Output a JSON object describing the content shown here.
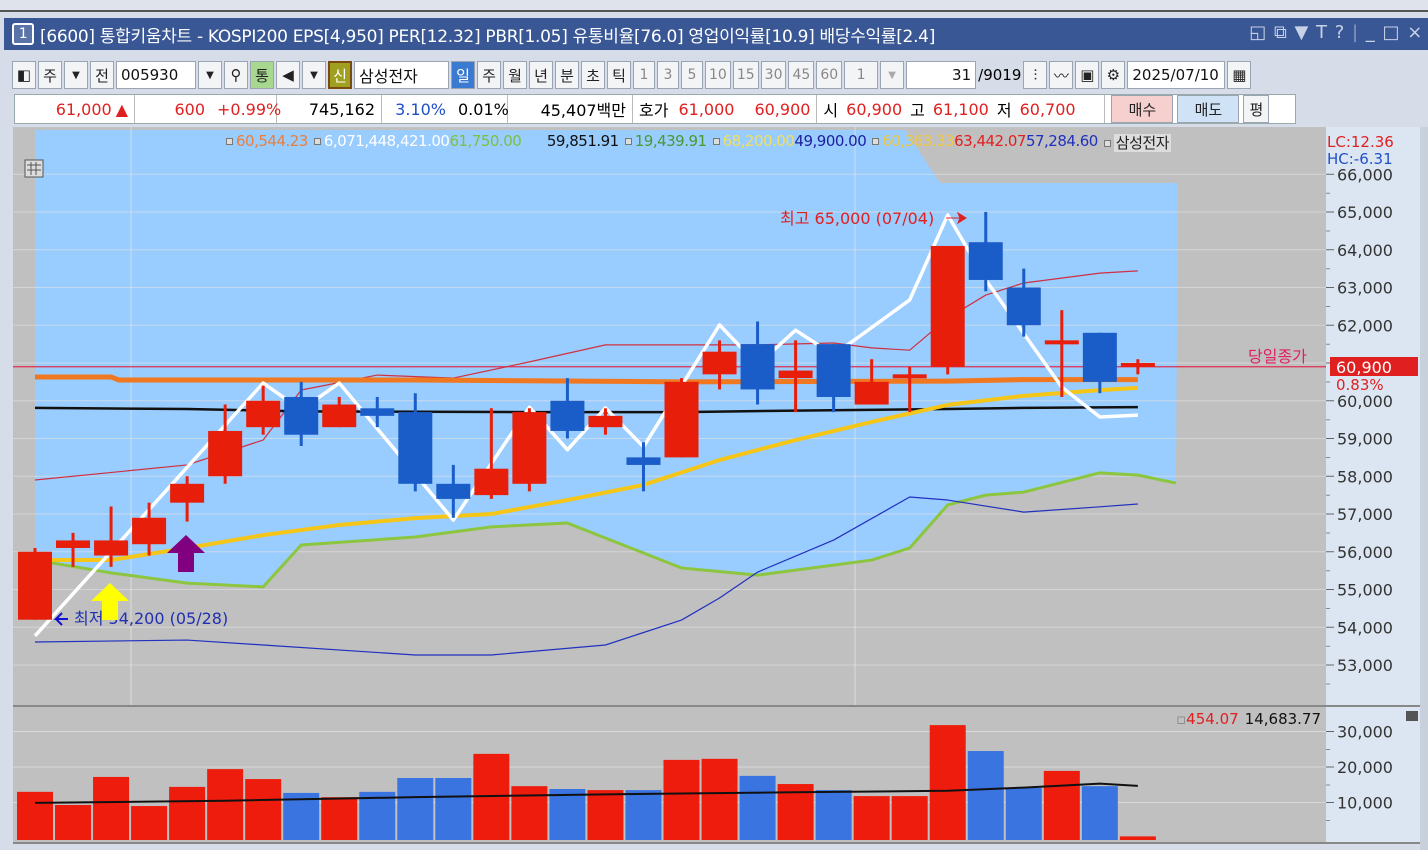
{
  "title_bar": {
    "badge": "1",
    "text": "[6600] 통합키움차트 - KOSPI200 EPS[4,950] PER[12.32] PBR[1.05] 유통비율[76.0] 영업이익률[10.9] 배당수익률[2.4]",
    "icons": [
      "window-icon",
      "restore-icon",
      "pin-icon",
      "font-icon",
      "help-icon",
      "minimize-icon",
      "maximize-icon",
      "close-icon"
    ],
    "icon_glyphs": [
      "◱",
      "⧉",
      "🖈",
      "T",
      "?",
      "_",
      "□",
      "×"
    ]
  },
  "toolbar": {
    "market": "주",
    "prev": "전",
    "code": "005930",
    "tong": "통",
    "new": "신",
    "name": "삼성전자",
    "periods": [
      "일",
      "주",
      "월",
      "년",
      "분",
      "초",
      "틱"
    ],
    "active_period": "일",
    "intervals": [
      "1",
      "3",
      "5",
      "10",
      "15",
      "30",
      "45",
      "60"
    ],
    "interval_select": "1",
    "count": "31",
    "total": "/9019",
    "date": "2025/07/10"
  },
  "info": {
    "price": "61,000",
    "arrow": "▲",
    "change": "600",
    "change_pct": "+0.99%",
    "volume": "745,162",
    "turnover": "3.10%",
    "ratio": "0.01%",
    "amount": "45,407백만",
    "quote_label": "호가",
    "ask": "61,000",
    "bid": "60,900",
    "open_label": "시",
    "open": "60,900",
    "high_label": "고",
    "high": "61,100",
    "low_label": "저",
    "low": "60,700",
    "buy": "매수",
    "sell": "매도",
    "avg": "평"
  },
  "legend": [
    {
      "text": "60,544.23",
      "color": "#e8803a",
      "box": true
    },
    {
      "text": "6,071,448,421.00",
      "color": "#ffffff",
      "box": true
    },
    {
      "text": "61,750.00",
      "color": "#7cc040",
      "box": false
    },
    {
      "text": "      59,851.91",
      "color": "#111111",
      "box": false
    },
    {
      "text": "19,439.91",
      "color": "#4a9a30",
      "box": true
    },
    {
      "text": "68,200.00",
      "color": "#f0e060",
      "box": true
    },
    {
      "text": "49,900.00",
      "color": "#2020a0",
      "box": false
    },
    {
      "text": "60,363.33",
      "color": "#f0c840",
      "box": true
    },
    {
      "text": "63,442.07",
      "color": "#e02020",
      "box": false
    },
    {
      "text": "57,284.60",
      "color": "#2030c0",
      "box": false
    },
    {
      "text": "삼성전자",
      "color": "#222222",
      "box": true
    }
  ],
  "indicators": {
    "lc": "LC:12.36",
    "hc": "HC:-6.31"
  },
  "annotations": {
    "high": "최고 65,000 (07/04)",
    "low": "최저 54,200 (05/28)",
    "close_label": "당일종가",
    "close_price": "60,900",
    "close_pct": "0.83%"
  },
  "volume_legend": {
    "v1": "454.07",
    "v2": "14,683.77"
  },
  "chart_data": {
    "type": "candlestick",
    "price_ticks": [
      "66,000",
      "65,000",
      "64,000",
      "63,000",
      "62,000",
      "61,000",
      "60,000",
      "59,000",
      "58,000",
      "57,000",
      "56,000",
      "55,000",
      "54,000",
      "53,000"
    ],
    "price_tick_values": [
      66000,
      65000,
      64000,
      63000,
      62000,
      61000,
      60000,
      59000,
      58000,
      57000,
      56000,
      55000,
      54000,
      53000
    ],
    "volume_ticks": [
      "30,000",
      "20,000",
      "10,000"
    ],
    "volume_tick_values": [
      30000,
      20000,
      10000
    ],
    "candles": [
      {
        "o": 54200,
        "h": 56100,
        "l": 54200,
        "c": 56000
      },
      {
        "o": 56100,
        "h": 56500,
        "l": 55600,
        "c": 56300
      },
      {
        "o": 55900,
        "h": 57200,
        "l": 55600,
        "c": 56300
      },
      {
        "o": 56200,
        "h": 57300,
        "l": 55900,
        "c": 56900
      },
      {
        "o": 57300,
        "h": 58000,
        "l": 56800,
        "c": 57800
      },
      {
        "o": 58000,
        "h": 59900,
        "l": 57800,
        "c": 59200
      },
      {
        "o": 59300,
        "h": 60400,
        "l": 59100,
        "c": 60000
      },
      {
        "o": 60100,
        "h": 60500,
        "l": 58800,
        "c": 59100
      },
      {
        "o": 59300,
        "h": 60100,
        "l": 59300,
        "c": 59900
      },
      {
        "o": 59800,
        "h": 60100,
        "l": 59300,
        "c": 59600
      },
      {
        "o": 59700,
        "h": 60200,
        "l": 57600,
        "c": 57800
      },
      {
        "o": 57800,
        "h": 58300,
        "l": 56900,
        "c": 57400
      },
      {
        "o": 57500,
        "h": 59800,
        "l": 57400,
        "c": 58200
      },
      {
        "o": 57800,
        "h": 59800,
        "l": 57600,
        "c": 59700
      },
      {
        "o": 60000,
        "h": 60600,
        "l": 59000,
        "c": 59200
      },
      {
        "o": 59300,
        "h": 59800,
        "l": 59100,
        "c": 59600
      },
      {
        "o": 58500,
        "h": 58900,
        "l": 57600,
        "c": 58300
      },
      {
        "o": 58500,
        "h": 60600,
        "l": 58500,
        "c": 60500
      },
      {
        "o": 60700,
        "h": 61600,
        "l": 60300,
        "c": 61300
      },
      {
        "o": 61500,
        "h": 62100,
        "l": 59900,
        "c": 60300
      },
      {
        "o": 60600,
        "h": 61600,
        "l": 59700,
        "c": 60800
      },
      {
        "o": 61500,
        "h": 61500,
        "l": 59700,
        "c": 60100
      },
      {
        "o": 59900,
        "h": 61100,
        "l": 59900,
        "c": 60500
      },
      {
        "o": 60600,
        "h": 60900,
        "l": 59700,
        "c": 60700
      },
      {
        "o": 60900,
        "h": 64100,
        "l": 60700,
        "c": 64100
      },
      {
        "o": 64200,
        "h": 65000,
        "l": 62900,
        "c": 63200
      },
      {
        "o": 63000,
        "h": 63500,
        "l": 61700,
        "c": 62000
      },
      {
        "o": 61500,
        "h": 62400,
        "l": 60100,
        "c": 61600
      },
      {
        "o": 61800,
        "h": 61800,
        "l": 60200,
        "c": 60500
      },
      {
        "o": 60900,
        "h": 61100,
        "l": 60700,
        "c": 61000
      }
    ],
    "volume": [
      13000,
      9300,
      17200,
      9000,
      14400,
      19400,
      16600,
      12700,
      11500,
      13000,
      16900,
      16900,
      23700,
      14600,
      13800,
      13500,
      13500,
      22000,
      22300,
      17500,
      15200,
      13500,
      11800,
      11800,
      31800,
      24500,
      14100,
      18900,
      14600,
      454
    ],
    "volume_up": [
      true,
      true,
      true,
      true,
      true,
      true,
      true,
      false,
      true,
      false,
      false,
      false,
      true,
      true,
      false,
      true,
      false,
      true,
      true,
      false,
      true,
      false,
      true,
      true,
      true,
      false,
      false,
      true,
      false,
      true
    ],
    "volume_ma": [
      [
        0,
        9900
      ],
      [
        5,
        10500
      ],
      [
        10,
        11500
      ],
      [
        15,
        12300
      ],
      [
        20,
        12900
      ],
      [
        24,
        13300
      ],
      [
        26,
        14200
      ],
      [
        28,
        15300
      ],
      [
        29,
        14700
      ]
    ],
    "lines": [
      {
        "name": "green-span",
        "color": "#8cc63f",
        "width": 3,
        "points": [
          [
            0,
            55780
          ],
          [
            2,
            55440
          ],
          [
            4,
            55170
          ],
          [
            6,
            55070
          ],
          [
            7,
            56180
          ],
          [
            10,
            56390
          ],
          [
            12,
            56660
          ],
          [
            14,
            56760
          ],
          [
            17,
            55570
          ],
          [
            19,
            55380
          ],
          [
            22,
            55780
          ],
          [
            23,
            56100
          ],
          [
            24,
            57240
          ],
          [
            25,
            57500
          ],
          [
            26,
            57580
          ],
          [
            28,
            58090
          ],
          [
            29,
            58030
          ],
          [
            30,
            57820
          ]
        ]
      },
      {
        "name": "upper-band",
        "color": "#d03040",
        "width": 1.2,
        "points": [
          [
            0,
            57900
          ],
          [
            4,
            58300
          ],
          [
            6,
            58960
          ],
          [
            7,
            60285
          ],
          [
            9,
            60680
          ],
          [
            11,
            60600
          ],
          [
            13,
            61030
          ],
          [
            15,
            61480
          ],
          [
            17,
            61480
          ],
          [
            19,
            61480
          ],
          [
            21,
            61530
          ],
          [
            22,
            61400
          ],
          [
            23,
            61340
          ],
          [
            24,
            62190
          ],
          [
            25,
            62800
          ],
          [
            26,
            63120
          ],
          [
            28,
            63380
          ],
          [
            29,
            63440
          ]
        ]
      },
      {
        "name": "lower-band",
        "color": "#2030c0",
        "width": 1.2,
        "points": [
          [
            0,
            53610
          ],
          [
            4,
            53660
          ],
          [
            6,
            53530
          ],
          [
            10,
            53265
          ],
          [
            12,
            53265
          ],
          [
            15,
            53530
          ],
          [
            17,
            54190
          ],
          [
            18,
            54775
          ],
          [
            19,
            55460
          ],
          [
            21,
            56310
          ],
          [
            23,
            57450
          ],
          [
            24,
            57370
          ],
          [
            26,
            57050
          ],
          [
            28,
            57190
          ],
          [
            29,
            57265
          ]
        ]
      },
      {
        "name": "orange-ma",
        "color": "#f07820",
        "width": 5,
        "points": [
          [
            0,
            60630
          ],
          [
            2,
            60630
          ],
          [
            2.2,
            60550
          ],
          [
            10,
            60550
          ],
          [
            17,
            60500
          ],
          [
            24,
            60520
          ],
          [
            26,
            60560
          ],
          [
            29,
            60560
          ]
        ]
      },
      {
        "name": "black-ma",
        "color": "#111111",
        "width": 2.5,
        "points": [
          [
            0,
            59810
          ],
          [
            4,
            59780
          ],
          [
            7,
            59720
          ],
          [
            13,
            59700
          ],
          [
            17,
            59700
          ],
          [
            20,
            59740
          ],
          [
            24,
            59780
          ],
          [
            26,
            59810
          ],
          [
            29,
            59830
          ]
        ]
      },
      {
        "name": "yellow-ma",
        "color": "#f5c518",
        "width": 4,
        "points": [
          [
            0,
            55780
          ],
          [
            2,
            55780
          ],
          [
            4,
            56100
          ],
          [
            6,
            56440
          ],
          [
            8,
            56710
          ],
          [
            10,
            56890
          ],
          [
            12,
            57000
          ],
          [
            14,
            57370
          ],
          [
            16,
            57770
          ],
          [
            18,
            58430
          ],
          [
            20,
            58960
          ],
          [
            22,
            59440
          ],
          [
            24,
            59890
          ],
          [
            26,
            60130
          ],
          [
            28,
            60280
          ],
          [
            29,
            60340
          ]
        ]
      },
      {
        "name": "zigzag",
        "color": "#ffffff",
        "width": 3.5,
        "points": [
          [
            0,
            53770
          ],
          [
            6,
            60470
          ],
          [
            7,
            59760
          ],
          [
            8,
            60470
          ],
          [
            11,
            56840
          ],
          [
            13,
            59830
          ],
          [
            14,
            58700
          ],
          [
            15,
            59810
          ],
          [
            16,
            58780
          ],
          [
            18,
            62010
          ],
          [
            19,
            60950
          ],
          [
            20,
            61870
          ],
          [
            21,
            61210
          ],
          [
            23,
            62670
          ],
          [
            24,
            64920
          ],
          [
            25,
            63200
          ],
          [
            27,
            60360
          ],
          [
            28,
            59570
          ],
          [
            29,
            59620
          ]
        ]
      }
    ],
    "close_line": 60900,
    "signals": [
      {
        "index": 2,
        "type": "buy",
        "color": "#ffff00"
      },
      {
        "index": 4,
        "type": "buy",
        "color": "#800080"
      }
    ]
  }
}
